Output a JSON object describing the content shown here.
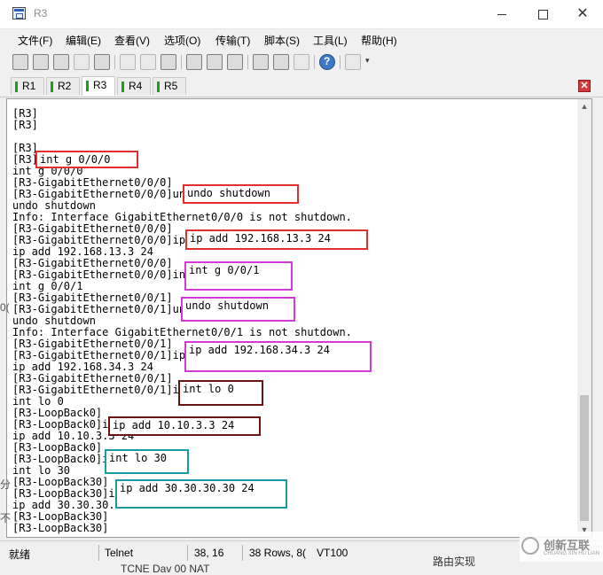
{
  "window": {
    "title": "R3"
  },
  "menu": {
    "items": [
      "文件(F)",
      "编辑(E)",
      "查看(V)",
      "选项(O)",
      "传输(T)",
      "脚本(S)",
      "工具(L)",
      "帮助(H)"
    ]
  },
  "toolbar": {
    "buttons": [
      "connect-icon",
      "quick-connect-icon",
      "session-icon",
      "reconnect-icon",
      "disconnect-icon",
      "copy-icon",
      "paste-icon",
      "find-icon",
      "print-icon",
      "print-setup-icon",
      "properties-icon",
      "map-keys-icon",
      "keymap-icon",
      "help-icon",
      "sftp-icon"
    ]
  },
  "tabs": {
    "items": [
      "R1",
      "R2",
      "R3",
      "R4",
      "R5"
    ],
    "active": "R3"
  },
  "terminal": {
    "lines": [
      "[R3]",
      "[R3]",
      "",
      "[R3]",
      "[R3]int g 0/0/0",
      "int g 0/0/0",
      "[R3-GigabitEthernet0/0/0]",
      "[R3-GigabitEthernet0/0/0]undo shutdown",
      "undo shutdown",
      "Info: Interface GigabitEthernet0/0/0 is not shutdown.",
      "[R3-GigabitEthernet0/0/0]",
      "[R3-GigabitEthernet0/0/0]ip add 192.168.13.3 24",
      "ip add 192.168.13.3 24",
      "[R3-GigabitEthernet0/0/0]",
      "[R3-GigabitEthernet0/0/0]int g 0/0/1",
      "int g 0/0/1",
      "[R3-GigabitEthernet0/0/1]",
      "[R3-GigabitEthernet0/0/1]undo shutdown",
      "undo shutdown",
      "Info: Interface GigabitEthernet0/0/1 is not shutdown.",
      "[R3-GigabitEthernet0/0/1]",
      "[R3-GigabitEthernet0/0/1]ip add 192.168.34.3 24",
      "ip add 192.168.34.3 24",
      "[R3-GigabitEthernet0/0/1]",
      "[R3-GigabitEthernet0/0/1]int lo 0",
      "int lo 0",
      "[R3-LoopBack0]",
      "[R3-LoopBack0]ip add 10.10.3.3 24",
      "ip add 10.10.3.3 24",
      "[R3-LoopBack0]",
      "[R3-LoopBack0]int lo 30",
      "int lo 30",
      "[R3-LoopBack30]",
      "[R3-LoopBack30]ip add 30.30.30.30 24",
      "ip add 30.30.30.30 24",
      "[R3-LoopBack30]",
      "[R3-LoopBack30]"
    ]
  },
  "highlights": [
    {
      "text": "int g 0/0/0",
      "color": "#e0312e"
    },
    {
      "text": "undo shutdown",
      "color": "#e0312e"
    },
    {
      "text": "ip add 192.168.13.3 24",
      "color": "#e0312e"
    },
    {
      "text": "int g 0/0/1",
      "color": "#d33ad8"
    },
    {
      "text": "undo shutdown",
      "color": "#d33ad8"
    },
    {
      "text": "ip add 192.168.34.3 24",
      "color": "#d33ad8"
    },
    {
      "text": "int lo 0",
      "color": "#6c1414"
    },
    {
      "text": "ip add 10.10.3.3 24",
      "color": "#6c1414"
    },
    {
      "text": "int lo 30",
      "color": "#1b9aa2"
    },
    {
      "text": "ip add 30.30.30.30 24",
      "color": "#1b9aa2"
    }
  ],
  "status": {
    "state": "就绪",
    "protocol": "Telnet",
    "cursor": "38, 16",
    "size": "38 Rows, 8(",
    "emulation": "VT100"
  },
  "background_text": {
    "bottom": "TCNE Dav 00 NAT",
    "bottom_right": "路由实现",
    "left_1": "0(",
    "left_2": "分",
    "left_3": "不"
  },
  "watermark": {
    "brand": "创新互联",
    "tagline": "CHUANG XIN HU LIAN"
  }
}
